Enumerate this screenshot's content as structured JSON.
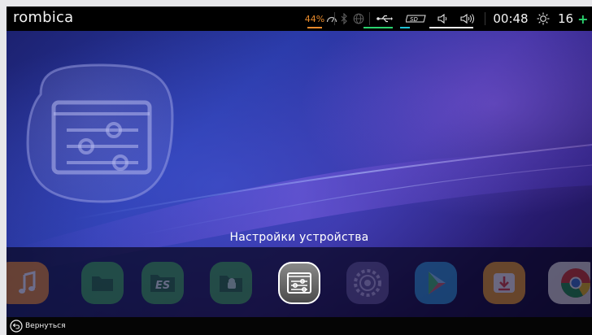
{
  "status_bar": {
    "brand": "rombica",
    "battery_percent_text": "44%",
    "time": "00:48",
    "brightness_value": "16",
    "brightness_plus": "+",
    "icons": [
      "gauge-icon",
      "bluetooth-icon",
      "globe-icon",
      "usb-icon",
      "sd-card-icon",
      "volume-down-icon",
      "volume-up-icon",
      "brightness-icon"
    ],
    "colors": {
      "battery": "#e98b2c",
      "usb_underline": "#2bd46f",
      "sd_underline": "#1ec3d6",
      "volume_underline": "#f0f0f0",
      "plus": "#2bd46f"
    }
  },
  "selected_app": {
    "title": "Настройки устройства",
    "icon": "settings-sliders-icon"
  },
  "dock": {
    "apps": [
      {
        "icon": "music-icon",
        "color": "#f08a1f"
      },
      {
        "icon": "folder-icon",
        "color": "#3aa54a"
      },
      {
        "icon": "es-file-explorer-icon",
        "color": "#3aa54a",
        "label": "ES"
      },
      {
        "icon": "android-folder-icon",
        "color": "#3aa54a"
      },
      {
        "icon": "settings-sliders-icon",
        "color": "#6b6b6b",
        "selected": true
      },
      {
        "icon": "gear-icon",
        "color": "#7a6ba8"
      },
      {
        "icon": "play-store-icon",
        "color": "#2b9bd8"
      },
      {
        "icon": "download-icon",
        "color": "#f5a623"
      },
      {
        "icon": "chrome-icon",
        "color": "#dd3b2c"
      }
    ]
  },
  "bottom_bar": {
    "back_label": "Вернуться",
    "back_icon": "back-arrow-icon"
  }
}
